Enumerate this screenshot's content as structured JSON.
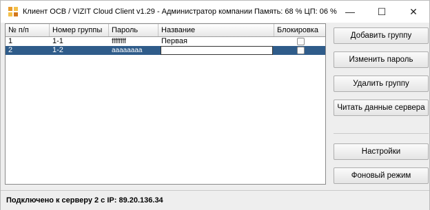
{
  "window": {
    "title": "Клиент ОСВ / VIZIT Cloud Client v1.29 - Администратор компании",
    "stats": "Память: 68 %  ЦП: 06 %",
    "minimize": "—",
    "maximize": "☐",
    "close": "✕"
  },
  "table": {
    "headers": [
      "№ п/п",
      "Номер группы",
      "Пароль",
      "Название",
      "Блокировка"
    ],
    "rows": [
      {
        "num": "1",
        "group": "1-1",
        "password": "ffffffff",
        "name": "Первая",
        "locked": false
      },
      {
        "num": "2",
        "group": "1-2",
        "password": "aaaaaaaa",
        "name": "",
        "locked": false
      }
    ]
  },
  "buttons": {
    "add_group": "Добавить группу",
    "change_password": "Изменить пароль",
    "delete_group": "Удалить группу",
    "read_server": "Читать данные сервера",
    "settings": "Настройки",
    "background_mode": "Фоновый режим"
  },
  "status": {
    "text": "Подключено к серверу 2 с IP:  89.20.136.34"
  },
  "colors": {
    "selected_row": "#2f5c8a",
    "icon_primary": "#e89b2b"
  }
}
